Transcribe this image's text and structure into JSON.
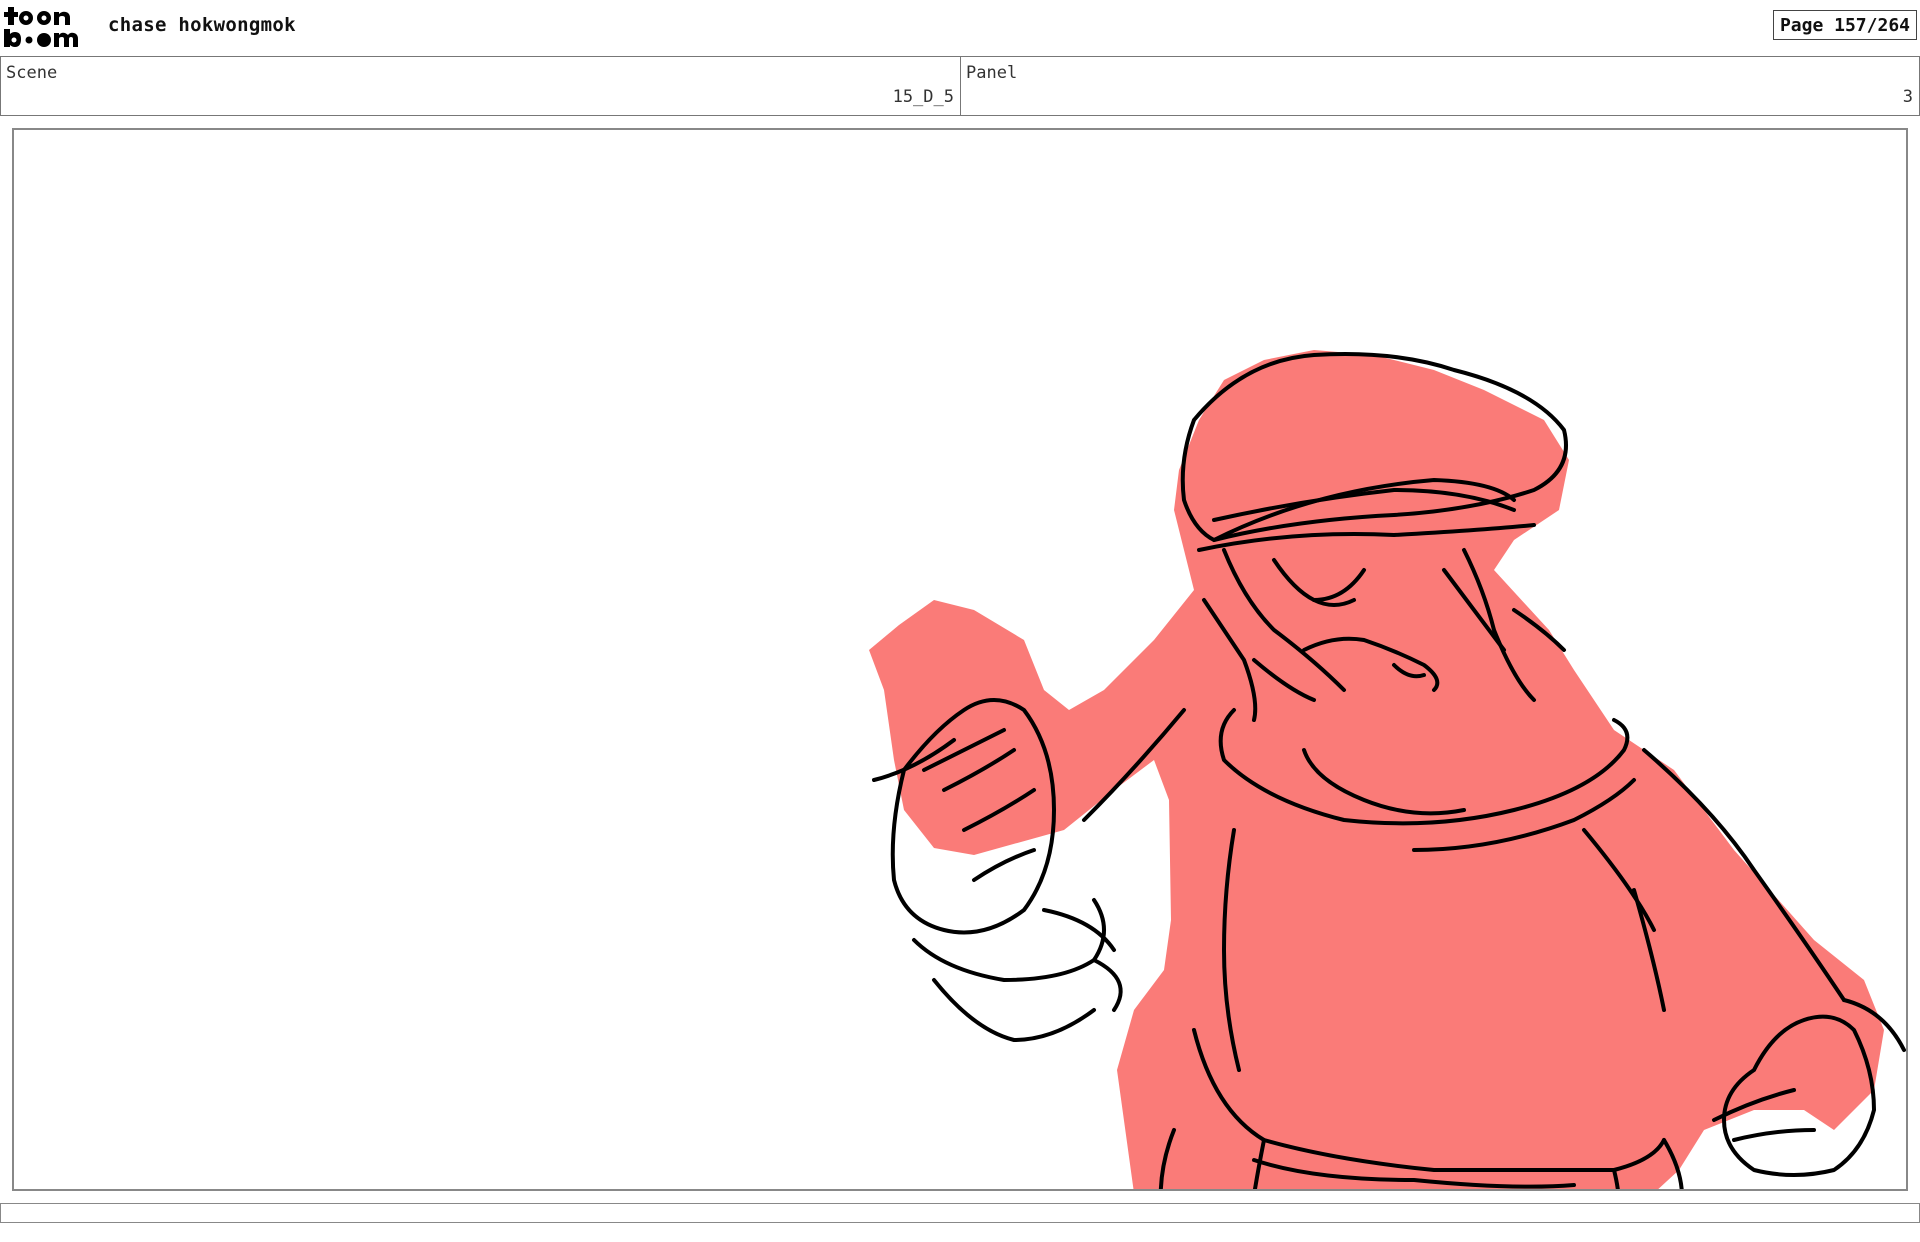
{
  "header": {
    "logo_text": "toon boom",
    "author": "chase hokwongmok",
    "page": "Page 157/264"
  },
  "info": {
    "scene_label": "Scene",
    "scene_value": "15_D_5",
    "panel_label": "Panel",
    "panel_value": "3"
  },
  "colors": {
    "sketch_fill": "#fa7b78",
    "line": "#000000",
    "frame_border": "#888888"
  }
}
